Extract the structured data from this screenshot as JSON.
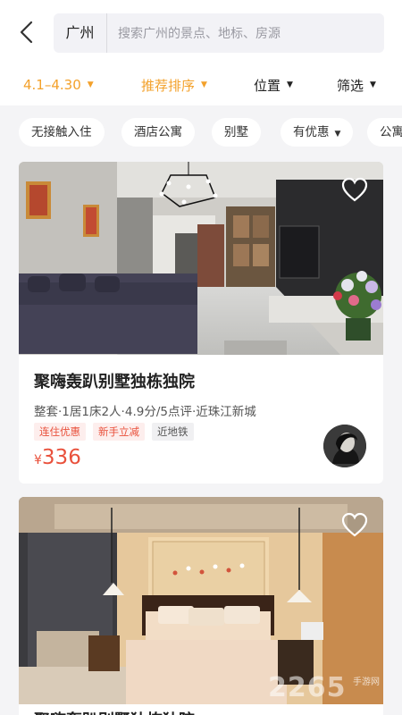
{
  "header": {
    "city": "广州",
    "search_placeholder": "搜索广州的景点、地标、房源"
  },
  "filters": {
    "date": "4.1–4.30",
    "sort": "推荐排序",
    "location": "位置",
    "more": "筛选"
  },
  "tags": [
    "无接触入住",
    "酒店公寓",
    "别墅",
    "有优惠",
    "公寓"
  ],
  "listings": [
    {
      "title": "聚嗨轰趴别墅独栋独院",
      "meta": "整套·1居1床2人·4.9分/5点评·近珠江新城",
      "badges": [
        "连住优惠",
        "新手立减",
        "近地铁"
      ],
      "currency": "¥",
      "price": "336"
    },
    {
      "title": "聚嗨轰趴别墅独栋独院"
    }
  ],
  "watermark": "2265",
  "watermark_sub": "手游网",
  "colors": {
    "accent": "#f3a12b",
    "price": "#e9513c"
  }
}
